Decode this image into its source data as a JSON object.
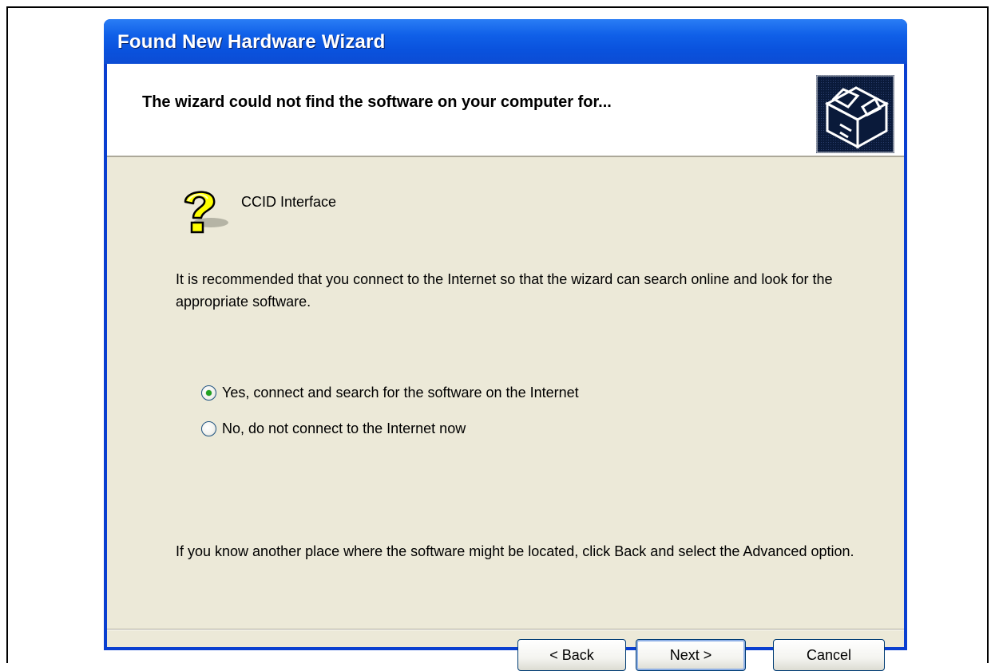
{
  "window": {
    "title": "Found New Hardware Wizard"
  },
  "header": {
    "title": "The wizard could not find the software on your computer for...",
    "icon": "hardware-box-icon"
  },
  "device": {
    "icon": "question-mark-icon",
    "name": "CCID Interface"
  },
  "messages": {
    "recommendation": "It is recommended that you connect to the Internet so that the wizard can search online and look for the appropriate software.",
    "advanced_hint": "If you know another place where the software might be located, click Back and select the Advanced option."
  },
  "options": [
    {
      "label": "Yes, connect and search for the software on the Internet",
      "selected": true
    },
    {
      "label": "No, do not connect to the Internet now",
      "selected": false
    }
  ],
  "buttons": {
    "back": "< Back",
    "next": "Next >",
    "cancel": "Cancel"
  },
  "colors": {
    "titlebar": "#0a52dd",
    "client_bg": "#ece9d8",
    "radio_dot": "#21a121"
  }
}
